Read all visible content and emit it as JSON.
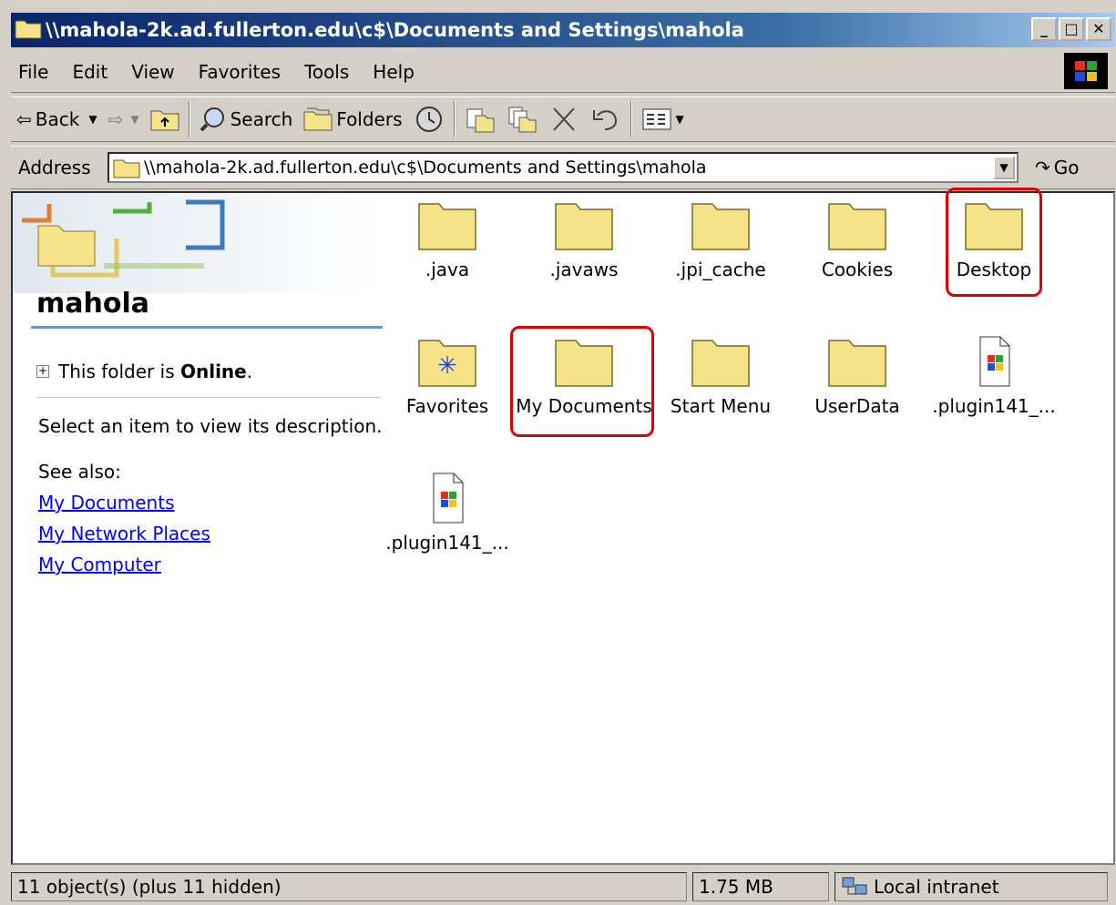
{
  "window": {
    "title": "\\\\mahola-2k.ad.fullerton.edu\\c$\\Documents and Settings\\mahola"
  },
  "menu": [
    "File",
    "Edit",
    "View",
    "Favorites",
    "Tools",
    "Help"
  ],
  "toolbar": {
    "back": "Back",
    "search": "Search",
    "folders": "Folders"
  },
  "address": {
    "label": "Address",
    "value": "\\\\mahola-2k.ad.fullerton.edu\\c$\\Documents and Settings\\mahola",
    "go": "Go"
  },
  "leftpane": {
    "folder_name": "mahola",
    "online_prefix": "This folder is ",
    "online_state": "Online",
    "online_suffix": ".",
    "description": "Select an item to view its description.",
    "see_also": "See also:",
    "links": [
      "My Documents",
      "My Network Places",
      "My Computer"
    ]
  },
  "items": [
    {
      "label": ".java",
      "icon": "folder-icon"
    },
    {
      "label": ".javaws",
      "icon": "folder-icon"
    },
    {
      "label": ".jpi_cache",
      "icon": "folder-icon"
    },
    {
      "label": "Cookies",
      "icon": "folder-icon"
    },
    {
      "label": "Desktop",
      "icon": "folder-icon",
      "highlighted": true
    },
    {
      "label": "Favorites",
      "icon": "favorites-folder-icon"
    },
    {
      "label": "My Documents",
      "icon": "folder-icon",
      "highlighted": true
    },
    {
      "label": "Start Menu",
      "icon": "folder-icon"
    },
    {
      "label": "UserData",
      "icon": "folder-icon"
    },
    {
      "label": ".plugin141_...",
      "icon": "windows-file-icon"
    },
    {
      "label": ".plugin141_...",
      "icon": "windows-file-icon"
    }
  ],
  "status": {
    "objects": "11 object(s) (plus 11 hidden)",
    "size": "1.75 MB",
    "zone": "Local intranet"
  },
  "colors": {
    "titlebar": "#0a246a",
    "highlight": "#e00000",
    "link": "#0000ff"
  }
}
